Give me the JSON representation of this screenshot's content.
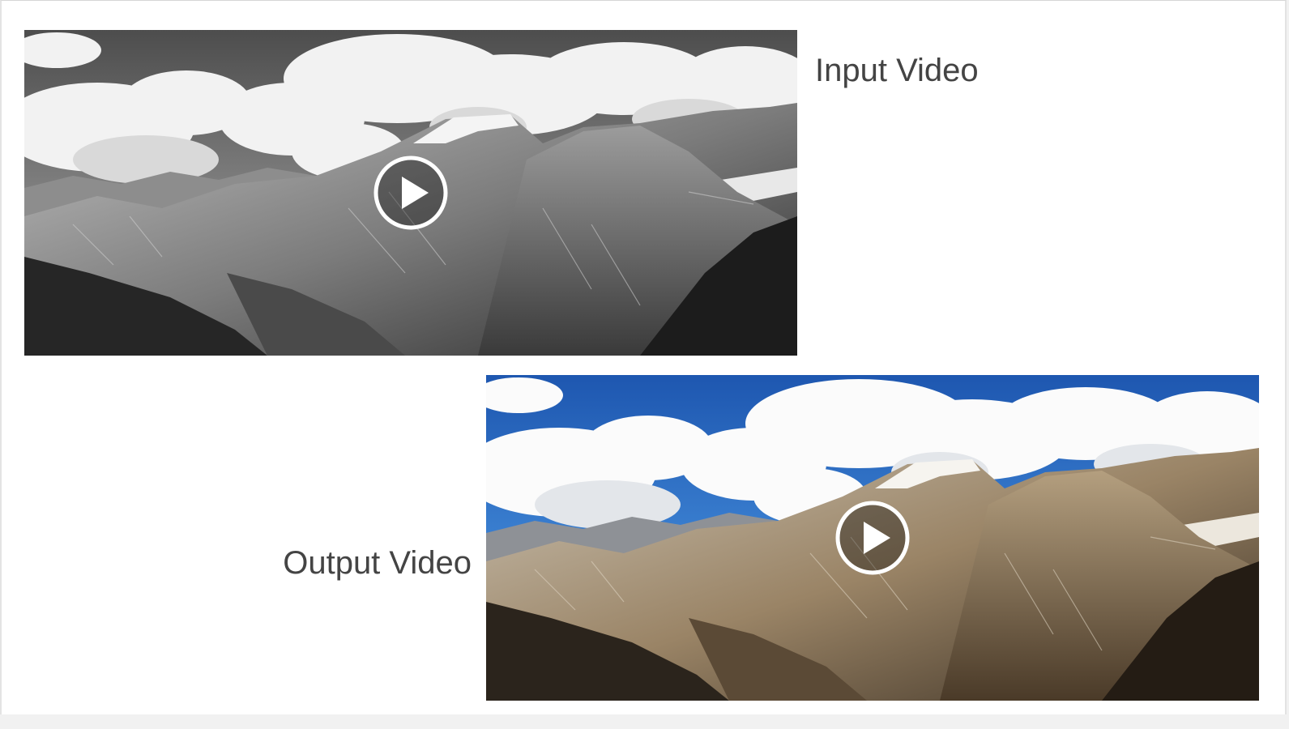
{
  "videos": {
    "input": {
      "label": "Input Video",
      "tone": "grayscale"
    },
    "output": {
      "label": "Output Video",
      "tone": "color"
    }
  },
  "icons": {
    "play": "play-icon"
  },
  "colors": {
    "label_text": "#444444",
    "page_background": "#ffffff",
    "sky_blue": "#2f6fc6",
    "rock_brown": "#8a7456"
  }
}
